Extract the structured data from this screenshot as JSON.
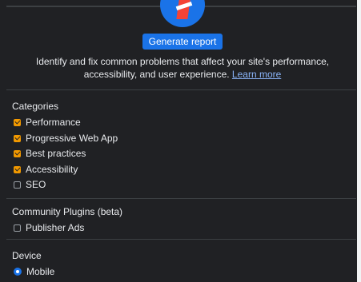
{
  "header": {
    "generate_label": "Generate report",
    "description": "Identify and fix common problems that affect your site's performance, accessibility, and user experience.",
    "learn_more": "Learn more"
  },
  "categories": {
    "title": "Categories",
    "items": [
      {
        "label": "Performance",
        "checked": true
      },
      {
        "label": "Progressive Web App",
        "checked": true
      },
      {
        "label": "Best practices",
        "checked": true
      },
      {
        "label": "Accessibility",
        "checked": true
      },
      {
        "label": "SEO",
        "checked": false
      }
    ]
  },
  "plugins": {
    "title": "Community Plugins (beta)",
    "items": [
      {
        "label": "Publisher Ads",
        "checked": false
      }
    ]
  },
  "device": {
    "title": "Device",
    "options": [
      {
        "label": "Mobile",
        "selected": true
      }
    ]
  },
  "colors": {
    "background": "#202124",
    "accent_blue": "#1a73e8",
    "checkbox_orange": "#f29900",
    "link": "#8ab4f8"
  },
  "icons": {
    "logo": "lighthouse-logo-icon"
  }
}
